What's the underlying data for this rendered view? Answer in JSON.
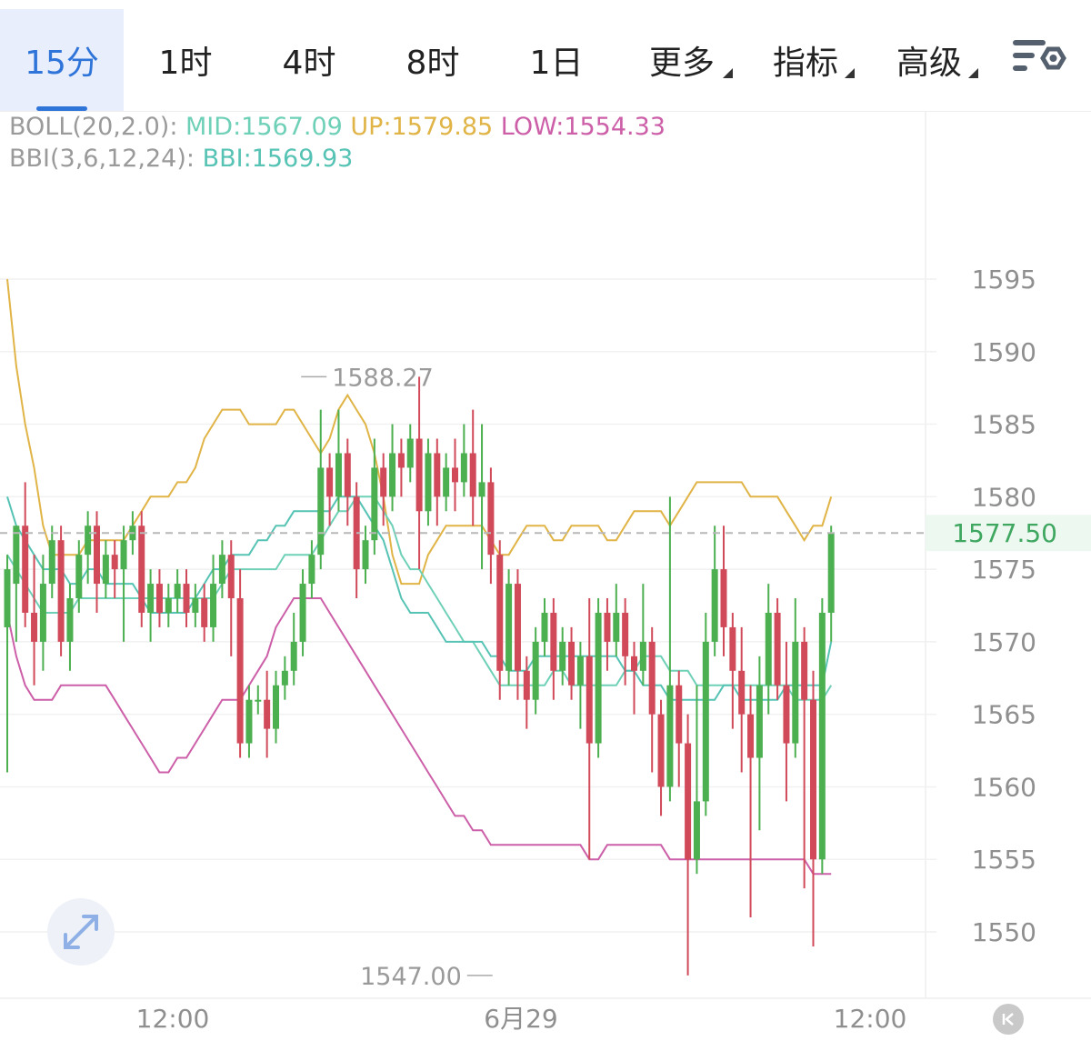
{
  "tabs": [
    {
      "label": "15分",
      "active": true
    },
    {
      "label": "1时"
    },
    {
      "label": "4时"
    },
    {
      "label": "8时"
    },
    {
      "label": "1日"
    },
    {
      "label": "更多",
      "dropdown": true
    },
    {
      "label": "指标",
      "dropdown": true
    },
    {
      "label": "高级",
      "dropdown": true
    }
  ],
  "icons": {
    "settings": "chart-settings-icon",
    "expand": "expand-icon",
    "back": "back-to-latest-icon"
  },
  "legend": {
    "boll_name": "BOLL(20,2.0): ",
    "mid": "MID:1567.09",
    "up": " UP:1579.85",
    "low": " LOW:1554.33",
    "bbi_name": "BBI(3,6,12,24): ",
    "bbi": "BBI:1569.93"
  },
  "colors": {
    "up_candle": "#4caf50",
    "down_candle": "#d14a5a",
    "boll_up": "#e0b446",
    "boll_mid": "#6fd0b8",
    "boll_low": "#cc5fa8",
    "bbi": "#56c3b4",
    "active_tab": "#2f74d8"
  },
  "chart_data": {
    "type": "candlestick",
    "timeframe": "15分",
    "y_axis": {
      "ticks": [
        1595,
        1590,
        1585,
        1580,
        1575,
        1570,
        1565,
        1560,
        1555,
        1550
      ],
      "range": [
        1546,
        1600
      ]
    },
    "x_axis": {
      "ticks": [
        {
          "label": "12:00",
          "index": 13
        },
        {
          "label": "6月29",
          "index": 40
        },
        {
          "label": "12:00",
          "index": 67
        }
      ]
    },
    "current_price": "1577.50",
    "high_marker": {
      "label": "1588.27",
      "value": 1588.27,
      "index": 32
    },
    "low_marker": {
      "label": "1547.00",
      "value": 1547.0,
      "index": 55
    },
    "candles": [
      [
        1571,
        1575,
        1561,
        1576
      ],
      [
        1574,
        1578,
        1570,
        1578
      ],
      [
        1578,
        1572,
        1571,
        1581
      ],
      [
        1572,
        1570,
        1567,
        1576
      ],
      [
        1570,
        1574,
        1568,
        1576
      ],
      [
        1574,
        1577,
        1573,
        1578
      ],
      [
        1577,
        1570,
        1569,
        1578
      ],
      [
        1570,
        1573,
        1568,
        1574
      ],
      [
        1573,
        1576,
        1572,
        1577
      ],
      [
        1576,
        1578,
        1574,
        1579
      ],
      [
        1578,
        1574,
        1572,
        1579
      ],
      [
        1574,
        1576,
        1573,
        1577
      ],
      [
        1576,
        1575,
        1573,
        1577
      ],
      [
        1575,
        1577,
        1570,
        1578
      ],
      [
        1577,
        1578,
        1576,
        1579
      ],
      [
        1578,
        1572,
        1571,
        1579
      ],
      [
        1572,
        1574,
        1570,
        1575
      ],
      [
        1574,
        1572,
        1571,
        1575
      ],
      [
        1572,
        1573,
        1571,
        1574
      ],
      [
        1573,
        1574,
        1572,
        1575
      ],
      [
        1574,
        1572,
        1571,
        1575
      ],
      [
        1572,
        1573,
        1571,
        1574
      ],
      [
        1573,
        1571,
        1570,
        1574
      ],
      [
        1571,
        1574,
        1570,
        1576
      ],
      [
        1574,
        1576,
        1573,
        1577
      ],
      [
        1576,
        1573,
        1569,
        1577
      ],
      [
        1573,
        1563,
        1562,
        1575
      ],
      [
        1563,
        1566,
        1562,
        1567
      ],
      [
        1566,
        1566,
        1565,
        1567
      ],
      [
        1566,
        1564,
        1562,
        1568
      ],
      [
        1564,
        1567,
        1563,
        1568
      ],
      [
        1567,
        1568,
        1566,
        1569
      ],
      [
        1568,
        1570,
        1567,
        1572
      ],
      [
        1570,
        1574,
        1569,
        1575
      ],
      [
        1574,
        1576,
        1573,
        1577
      ],
      [
        1576,
        1582,
        1575,
        1586
      ],
      [
        1582,
        1580,
        1578,
        1583
      ],
      [
        1580,
        1583,
        1579,
        1586
      ],
      [
        1583,
        1580,
        1578,
        1584
      ],
      [
        1580,
        1575,
        1573,
        1581
      ],
      [
        1575,
        1577,
        1574,
        1578
      ],
      [
        1577,
        1582,
        1576,
        1584
      ],
      [
        1582,
        1580,
        1578,
        1583
      ],
      [
        1580,
        1583,
        1579,
        1585
      ],
      [
        1583,
        1582,
        1580,
        1584
      ],
      [
        1582,
        1584,
        1581,
        1585
      ],
      [
        1584,
        1579,
        1575,
        1588.27
      ],
      [
        1579,
        1583,
        1578,
        1584
      ],
      [
        1583,
        1580,
        1578,
        1584
      ],
      [
        1580,
        1582,
        1579,
        1583
      ],
      [
        1582,
        1581,
        1579,
        1584
      ],
      [
        1581,
        1583,
        1580,
        1585
      ],
      [
        1583,
        1580,
        1578,
        1586
      ],
      [
        1580,
        1581,
        1575,
        1585
      ],
      [
        1581,
        1576,
        1574,
        1582
      ],
      [
        1576,
        1568,
        1566,
        1577
      ],
      [
        1568,
        1574,
        1567,
        1575
      ],
      [
        1574,
        1568,
        1566,
        1575
      ],
      [
        1568,
        1566,
        1564,
        1569
      ],
      [
        1566,
        1570,
        1565,
        1571
      ],
      [
        1570,
        1572,
        1569,
        1573
      ],
      [
        1572,
        1568,
        1566,
        1573
      ],
      [
        1568,
        1570,
        1567,
        1571
      ],
      [
        1570,
        1567,
        1566,
        1571
      ],
      [
        1567,
        1569,
        1564,
        1570
      ],
      [
        1569,
        1563,
        1555,
        1573
      ],
      [
        1563,
        1572,
        1562,
        1573
      ],
      [
        1572,
        1570,
        1568,
        1573
      ],
      [
        1570,
        1572,
        1569,
        1574
      ],
      [
        1572,
        1569,
        1567,
        1573
      ],
      [
        1569,
        1568,
        1565,
        1570
      ],
      [
        1568,
        1570,
        1567,
        1574
      ],
      [
        1570,
        1565,
        1561,
        1571
      ],
      [
        1565,
        1560,
        1558,
        1566
      ],
      [
        1560,
        1567,
        1559,
        1580
      ],
      [
        1567,
        1563,
        1560,
        1568
      ],
      [
        1563,
        1555,
        1547,
        1565
      ],
      [
        1555,
        1559,
        1554,
        1567
      ],
      [
        1559,
        1570,
        1558,
        1572
      ],
      [
        1570,
        1575,
        1569,
        1578
      ],
      [
        1575,
        1571,
        1569,
        1578
      ],
      [
        1571,
        1568,
        1564,
        1572
      ],
      [
        1568,
        1565,
        1561,
        1571
      ],
      [
        1565,
        1562,
        1551,
        1567
      ],
      [
        1562,
        1567,
        1557,
        1569
      ],
      [
        1567,
        1572,
        1565,
        1574
      ],
      [
        1572,
        1567,
        1566,
        1573
      ],
      [
        1567,
        1563,
        1559,
        1570
      ],
      [
        1563,
        1570,
        1562,
        1573
      ],
      [
        1570,
        1566,
        1553,
        1571
      ],
      [
        1566,
        1555,
        1549,
        1568
      ],
      [
        1555,
        1572,
        1554,
        1573
      ],
      [
        1572,
        1577.5,
        1570,
        1578
      ]
    ],
    "series": [
      {
        "name": "UP",
        "values": [
          1595,
          1589,
          1585,
          1582,
          1578,
          1576,
          1576,
          1576,
          1576,
          1577,
          1577,
          1577,
          1577,
          1577,
          1578,
          1579,
          1580,
          1580,
          1580,
          1581,
          1581,
          1582,
          1584,
          1585,
          1586,
          1586,
          1586,
          1585,
          1585,
          1585,
          1585,
          1586,
          1586,
          1585,
          1584,
          1583,
          1584,
          1586,
          1587,
          1586,
          1585,
          1583,
          1580,
          1576,
          1574,
          1574,
          1574,
          1576,
          1577,
          1578,
          1578,
          1578,
          1578,
          1578,
          1577,
          1576,
          1576,
          1577,
          1578,
          1578,
          1578,
          1577,
          1577,
          1578,
          1578,
          1578,
          1578,
          1577,
          1577,
          1578,
          1579,
          1579,
          1579,
          1579,
          1578,
          1579,
          1580,
          1581,
          1581,
          1581,
          1581,
          1581,
          1581,
          1580,
          1580,
          1580,
          1580,
          1579,
          1578,
          1577,
          1578,
          1578,
          1580
        ]
      },
      {
        "name": "MID",
        "values": [
          1576,
          1575,
          1574,
          1573,
          1572,
          1572,
          1572,
          1572,
          1573,
          1573,
          1573,
          1573,
          1573,
          1573,
          1573,
          1573,
          1573,
          1573,
          1573,
          1573,
          1573,
          1573,
          1573,
          1573,
          1574,
          1575,
          1575,
          1575,
          1575,
          1575,
          1575,
          1576,
          1576,
          1576,
          1576,
          1577,
          1578,
          1579,
          1579,
          1580,
          1580,
          1580,
          1579,
          1578,
          1576,
          1575,
          1575,
          1574,
          1573,
          1572,
          1571,
          1570,
          1570,
          1569,
          1568,
          1567,
          1567,
          1567,
          1567,
          1567,
          1567,
          1568,
          1568,
          1567,
          1567,
          1567,
          1567,
          1567,
          1567,
          1568,
          1568,
          1569,
          1569,
          1569,
          1568,
          1568,
          1568,
          1567,
          1567,
          1567,
          1567,
          1567,
          1567,
          1567,
          1567,
          1567,
          1567,
          1567,
          1566,
          1566,
          1566,
          1566,
          1567
        ]
      },
      {
        "name": "LOW",
        "values": [
          1572,
          1569,
          1567,
          1566,
          1566,
          1566,
          1567,
          1567,
          1567,
          1567,
          1567,
          1567,
          1566,
          1565,
          1564,
          1563,
          1562,
          1561,
          1561,
          1562,
          1562,
          1563,
          1564,
          1565,
          1566,
          1566,
          1566,
          1567,
          1568,
          1569,
          1571,
          1572,
          1573,
          1573,
          1573,
          1573,
          1572,
          1571,
          1570,
          1569,
          1568,
          1567,
          1566,
          1565,
          1564,
          1563,
          1562,
          1561,
          1560,
          1559,
          1558,
          1558,
          1557,
          1557,
          1556,
          1556,
          1556,
          1556,
          1556,
          1556,
          1556,
          1556,
          1556,
          1556,
          1556,
          1555,
          1555,
          1556,
          1556,
          1556,
          1556,
          1556,
          1556,
          1556,
          1555,
          1555,
          1555,
          1555,
          1555,
          1555,
          1555,
          1555,
          1555,
          1555,
          1555,
          1555,
          1555,
          1555,
          1555,
          1555,
          1554,
          1554,
          1554
        ]
      },
      {
        "name": "BBI",
        "values": [
          1580,
          1578,
          1577,
          1576,
          1575,
          1575,
          1575,
          1574,
          1574,
          1575,
          1575,
          1574,
          1574,
          1574,
          1574,
          1573,
          1572,
          1572,
          1572,
          1572,
          1572,
          1573,
          1574,
          1575,
          1575,
          1576,
          1576,
          1576,
          1577,
          1577,
          1578,
          1578,
          1579,
          1579,
          1579,
          1579,
          1579,
          1580,
          1580,
          1580,
          1579,
          1578,
          1577,
          1575,
          1573,
          1572,
          1572,
          1572,
          1571,
          1570,
          1570,
          1570,
          1570,
          1570,
          1569,
          1569,
          1568,
          1568,
          1568,
          1569,
          1569,
          1569,
          1569,
          1569,
          1569,
          1569,
          1569,
          1569,
          1569,
          1568,
          1568,
          1567,
          1567,
          1567,
          1566,
          1566,
          1566,
          1566,
          1566,
          1566,
          1567,
          1567,
          1566,
          1566,
          1566,
          1566,
          1566,
          1567,
          1567,
          1567,
          1567,
          1567,
          1570
        ]
      }
    ]
  }
}
